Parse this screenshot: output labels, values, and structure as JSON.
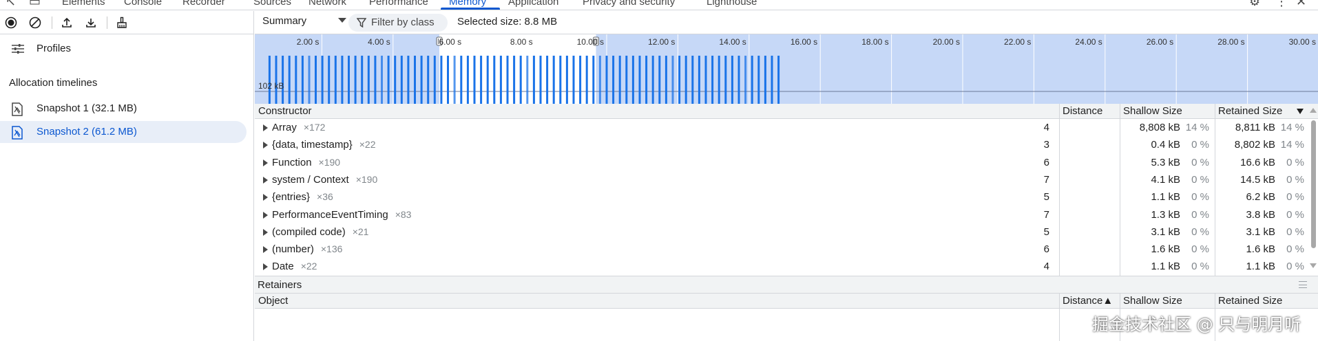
{
  "topbar": {
    "tabs": [
      {
        "label": "Elements"
      },
      {
        "label": "Console"
      },
      {
        "label": "Recorder"
      },
      {
        "label": "Sources"
      },
      {
        "label": "Network"
      },
      {
        "label": "Performance"
      },
      {
        "label": "Memory",
        "active": true
      },
      {
        "label": "Application"
      },
      {
        "label": "Privacy and security"
      },
      {
        "label": "Lighthouse"
      }
    ]
  },
  "sidebar": {
    "profiles_label": "Profiles",
    "section_title": "Allocation timelines",
    "snapshots": [
      {
        "label": "Snapshot 1 (32.1 MB)",
        "selected": false
      },
      {
        "label": "Snapshot 2 (61.2 MB)",
        "selected": true
      }
    ]
  },
  "toolbar": {
    "view_select": "Summary",
    "filter_label": "Filter by class",
    "selected_size": "Selected size: 8.8 MB"
  },
  "timeline": {
    "ticks": [
      "2.00 s",
      "4.00 s",
      "6.00 s",
      "8.00 s",
      "10.00 s",
      "12.00 s",
      "14.00 s",
      "16.00 s",
      "18.00 s",
      "20.00 s",
      "22.00 s",
      "24.00 s",
      "26.00 s",
      "28.00 s",
      "30.00 s"
    ],
    "axis_value": "102 kB",
    "accent": "#1a73e8",
    "selection_start_s": 5.3,
    "selection_end_s": 9.7,
    "activity_end_s": 14.9
  },
  "summary_table": {
    "headers": {
      "constructor": "Constructor",
      "distance": "Distance",
      "shallow": "Shallow Size",
      "retained": "Retained Size"
    },
    "rows": [
      {
        "name": "Array",
        "count": "×172",
        "distance": "4",
        "shallow": "8,808 kB",
        "shallow_pct": "14 %",
        "retained": "8,811 kB",
        "retained_pct": "14 %"
      },
      {
        "name": "{data, timestamp}",
        "count": "×22",
        "distance": "3",
        "shallow": "0.4 kB",
        "shallow_pct": "0 %",
        "retained": "8,802 kB",
        "retained_pct": "14 %"
      },
      {
        "name": "Function",
        "count": "×190",
        "distance": "6",
        "shallow": "5.3 kB",
        "shallow_pct": "0 %",
        "retained": "16.6 kB",
        "retained_pct": "0 %"
      },
      {
        "name": "system / Context",
        "count": "×190",
        "distance": "7",
        "shallow": "4.1 kB",
        "shallow_pct": "0 %",
        "retained": "14.5 kB",
        "retained_pct": "0 %"
      },
      {
        "name": "{entries}",
        "count": "×36",
        "distance": "5",
        "shallow": "1.1 kB",
        "shallow_pct": "0 %",
        "retained": "6.2 kB",
        "retained_pct": "0 %"
      },
      {
        "name": "PerformanceEventTiming",
        "count": "×83",
        "distance": "7",
        "shallow": "1.3 kB",
        "shallow_pct": "0 %",
        "retained": "3.8 kB",
        "retained_pct": "0 %"
      },
      {
        "name": "(compiled code)",
        "count": "×21",
        "distance": "5",
        "shallow": "3.1 kB",
        "shallow_pct": "0 %",
        "retained": "3.1 kB",
        "retained_pct": "0 %"
      },
      {
        "name": "(number)",
        "count": "×136",
        "distance": "6",
        "shallow": "1.6 kB",
        "shallow_pct": "0 %",
        "retained": "1.6 kB",
        "retained_pct": "0 %"
      },
      {
        "name": "Date",
        "count": "×22",
        "distance": "4",
        "shallow": "1.1 kB",
        "shallow_pct": "0 %",
        "retained": "1.1 kB",
        "retained_pct": "0 %"
      }
    ]
  },
  "retainers": {
    "title": "Retainers",
    "headers": {
      "object": "Object",
      "distance": "Distance▲",
      "shallow": "Shallow Size",
      "retained": "Retained Size"
    }
  },
  "watermark": "掘金技术社区 @ 只与明月听"
}
